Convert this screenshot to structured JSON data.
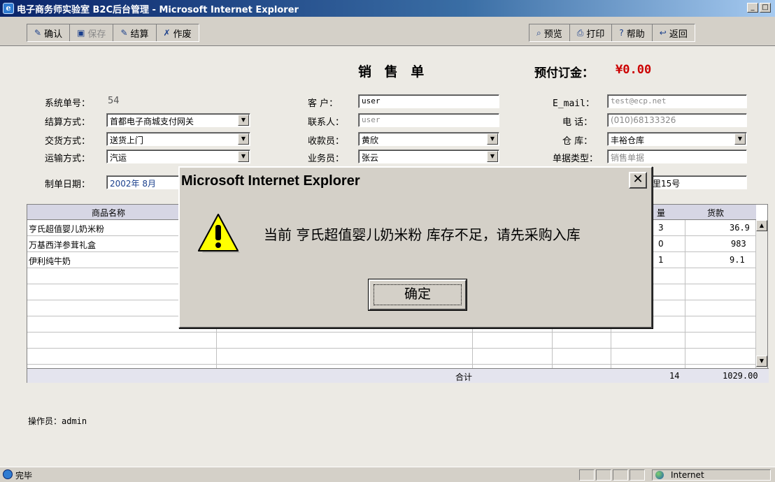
{
  "window": {
    "title": "电子商务师实验室 B2C后台管理 - Microsoft Internet Explorer",
    "ie_icon": "ie-logo-icon"
  },
  "toolbar": {
    "left": [
      {
        "label": "确认",
        "icon": "confirm-icon",
        "enabled": true
      },
      {
        "label": "保存",
        "icon": "save-icon",
        "enabled": false
      },
      {
        "label": "结算",
        "icon": "checkout-icon",
        "enabled": true
      },
      {
        "label": "作废",
        "icon": "void-icon",
        "enabled": true
      }
    ],
    "right": [
      {
        "label": "预览",
        "icon": "preview-icon"
      },
      {
        "label": "打印",
        "icon": "print-icon"
      },
      {
        "label": "帮助",
        "icon": "help-icon"
      },
      {
        "label": "返回",
        "icon": "back-icon"
      }
    ]
  },
  "form": {
    "title": "销 售 单",
    "deposit_label": "预付订金：",
    "deposit_value": "¥0.00",
    "order_no_label": "系统单号：",
    "order_no": "54",
    "settle_label": "结算方式：",
    "settle_value": "首都电子商城支付网关",
    "delivery_label": "交货方式：",
    "delivery_value": "送货上门",
    "transport_label": "运输方式：",
    "transport_value": "汽运",
    "date_label": "制单日期：",
    "date_value": "2002年  8月",
    "customer_label": "客  户：",
    "customer_value": "user",
    "contact_label": "联系人：",
    "contact_value": "user",
    "payee_label": "收款员：",
    "payee_value": "黄欣",
    "sales_label": "业务员：",
    "sales_value": "张云",
    "email_label": "E_mail：",
    "email_value": "test@ecp.net",
    "phone_label": "电  话：",
    "phone_value": "(010)68133326",
    "warehouse_label": "仓  库：",
    "warehouse_value": "丰裕仓库",
    "doc_type_label": "单据类型：",
    "doc_type_value": "销售单据",
    "address_partial": "淀区翠微中里15号"
  },
  "table": {
    "headers": {
      "product": "商品名称",
      "qty_partial": "量",
      "amount": "货款"
    },
    "rows": [
      {
        "product": "亨氏超值婴儿奶米粉",
        "qty": "3",
        "amount": "36.9"
      },
      {
        "product": "万基西洋参茸礼盒",
        "qty": "0",
        "amount": "983"
      },
      {
        "product": "伊利纯牛奶",
        "qty": "1",
        "amount": "9.1"
      }
    ],
    "total_label": "合计",
    "total_qty": "14",
    "total_amount": "1029.00"
  },
  "operator": "操作员：admin",
  "statusbar": {
    "status": "完毕",
    "zone": "Internet"
  },
  "dialog": {
    "title": "Microsoft Internet Explorer",
    "message": "当前 亨氏超值婴儿奶米粉 库存不足，请先采购入库",
    "ok_label": "确定",
    "icon": "warning-icon"
  }
}
